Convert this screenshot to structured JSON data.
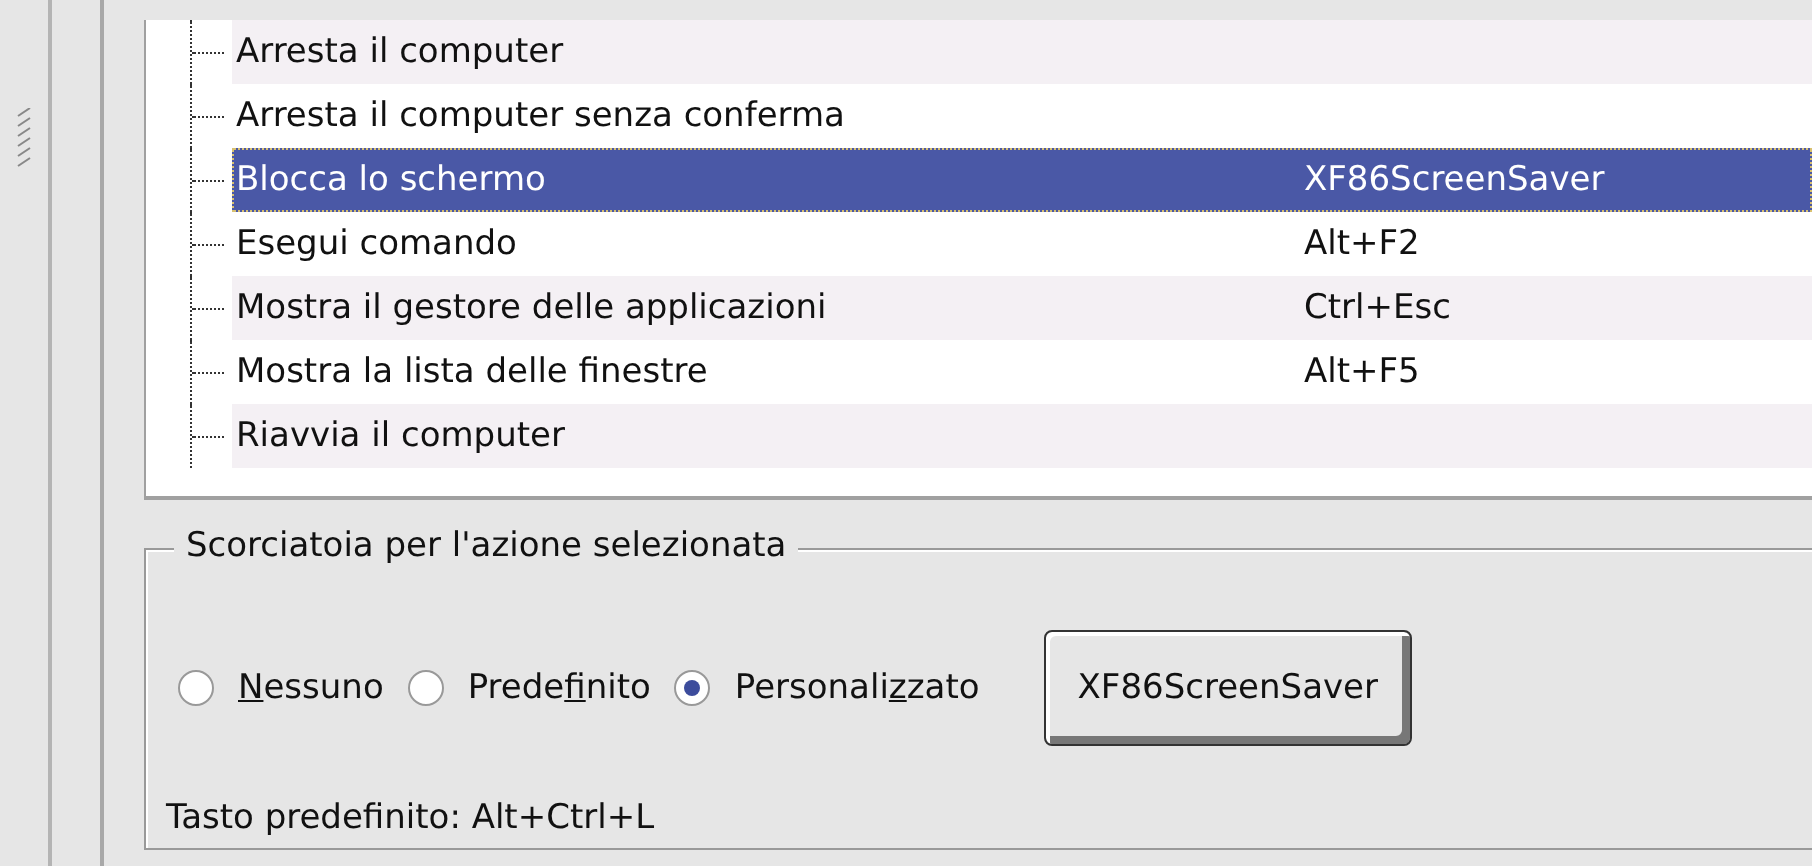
{
  "actions": [
    {
      "name": "Arresta il computer",
      "selected": false
    },
    {
      "name": "Arresta il computer senza conferma",
      "selected": false
    },
    {
      "name": "Blocca lo schermo",
      "shortcut": "XF86ScreenSaver",
      "selected": true
    },
    {
      "name": "Esegui comando",
      "shortcut": "Alt+F2",
      "selected": false
    },
    {
      "name": "Mostra il gestore delle applicazioni",
      "shortcut": "Ctrl+Esc",
      "selected": false
    },
    {
      "name": "Mostra la lista delle finestre",
      "shortcut": "Alt+F5",
      "selected": false
    },
    {
      "name": "Riavvia il computer",
      "selected": false
    }
  ],
  "shortcut_group": {
    "title": "Scorciatoia per l'azione selezionata",
    "options": [
      {
        "mnemonic": "N",
        "label_rest": "essuno",
        "selected": false
      },
      {
        "label_start": "Prede",
        "mnemonic": "f",
        "label_rest": "inito",
        "selected": false
      },
      {
        "label_start": "Personali",
        "mnemonic": "z",
        "label_rest": "zato",
        "selected": true
      }
    ],
    "key_button": "XF86ScreenSaver",
    "default_key": "Tasto predefinito: Alt+Ctrl+L"
  }
}
